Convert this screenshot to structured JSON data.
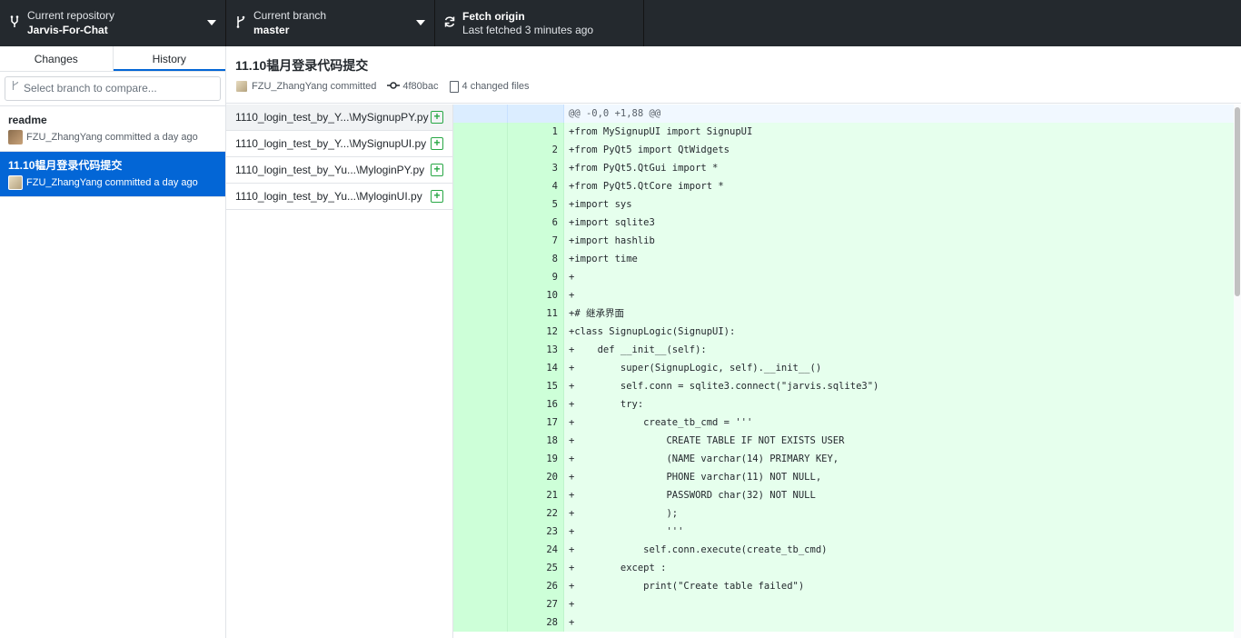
{
  "toolbar": {
    "repo_label": "Current repository",
    "repo_name": "Jarvis-For-Chat",
    "branch_label": "Current branch",
    "branch_name": "master",
    "fetch_label": "Fetch origin",
    "fetch_status": "Last fetched 3 minutes ago"
  },
  "sidebar": {
    "tabs": [
      {
        "label": "Changes"
      },
      {
        "label": "History"
      }
    ],
    "active_tab": "History",
    "compare_placeholder": "Select branch to compare...",
    "commits": [
      {
        "title": "readme",
        "meta": "FZU_ZhangYang committed a day ago"
      },
      {
        "title": "11.10韫月登录代码提交",
        "meta": "FZU_ZhangYang committed a day ago"
      }
    ]
  },
  "commit": {
    "title": "11.10韫月登录代码提交",
    "author": "FZU_ZhangYang committed",
    "sha": "4f80bac",
    "changed_files": "4 changed files"
  },
  "files": [
    {
      "name": "1110_login_test_by_Y...\\MySignupPY.py"
    },
    {
      "name": "1110_login_test_by_Y...\\MySignupUI.py"
    },
    {
      "name": "1110_login_test_by_Yu...\\MyloginPY.py"
    },
    {
      "name": "1110_login_test_by_Yu...\\MyloginUI.py"
    }
  ],
  "diff": {
    "hunk": "@@ -0,0 +1,88 @@",
    "lines": [
      {
        "n": "1",
        "t": "+from MySignupUI import SignupUI"
      },
      {
        "n": "2",
        "t": "+from PyQt5 import QtWidgets"
      },
      {
        "n": "3",
        "t": "+from PyQt5.QtGui import *"
      },
      {
        "n": "4",
        "t": "+from PyQt5.QtCore import *"
      },
      {
        "n": "5",
        "t": "+import sys"
      },
      {
        "n": "6",
        "t": "+import sqlite3"
      },
      {
        "n": "7",
        "t": "+import hashlib"
      },
      {
        "n": "8",
        "t": "+import time"
      },
      {
        "n": "9",
        "t": "+"
      },
      {
        "n": "10",
        "t": "+"
      },
      {
        "n": "11",
        "t": "+# 继承界面"
      },
      {
        "n": "12",
        "t": "+class SignupLogic(SignupUI):"
      },
      {
        "n": "13",
        "t": "+    def __init__(self):"
      },
      {
        "n": "14",
        "t": "+        super(SignupLogic, self).__init__()"
      },
      {
        "n": "15",
        "t": "+        self.conn = sqlite3.connect(\"jarvis.sqlite3\")"
      },
      {
        "n": "16",
        "t": "+        try:"
      },
      {
        "n": "17",
        "t": "+            create_tb_cmd = '''"
      },
      {
        "n": "18",
        "t": "+                CREATE TABLE IF NOT EXISTS USER"
      },
      {
        "n": "19",
        "t": "+                (NAME varchar(14) PRIMARY KEY,"
      },
      {
        "n": "20",
        "t": "+                PHONE varchar(11) NOT NULL,"
      },
      {
        "n": "21",
        "t": "+                PASSWORD char(32) NOT NULL"
      },
      {
        "n": "22",
        "t": "+                );"
      },
      {
        "n": "23",
        "t": "+                '''"
      },
      {
        "n": "24",
        "t": "+            self.conn.execute(create_tb_cmd)"
      },
      {
        "n": "25",
        "t": "+        except :"
      },
      {
        "n": "26",
        "t": "+            print(\"Create table failed\")"
      },
      {
        "n": "27",
        "t": "+"
      },
      {
        "n": "28",
        "t": "+"
      }
    ]
  }
}
